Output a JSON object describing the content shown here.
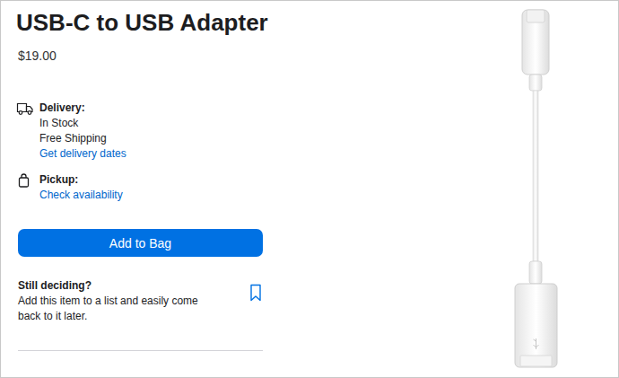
{
  "product": {
    "title": "USB-C to USB Adapter",
    "price": "$19.00"
  },
  "delivery": {
    "label": "Delivery:",
    "lines": [
      "In Stock",
      "Free Shipping"
    ],
    "link": "Get delivery dates"
  },
  "pickup": {
    "label": "Pickup:",
    "link": "Check availability"
  },
  "add_button": "Add to Bag",
  "save": {
    "title": "Still deciding?",
    "lines": [
      "Add this item to a list and easily come",
      "back to it later."
    ],
    "saved": false
  }
}
